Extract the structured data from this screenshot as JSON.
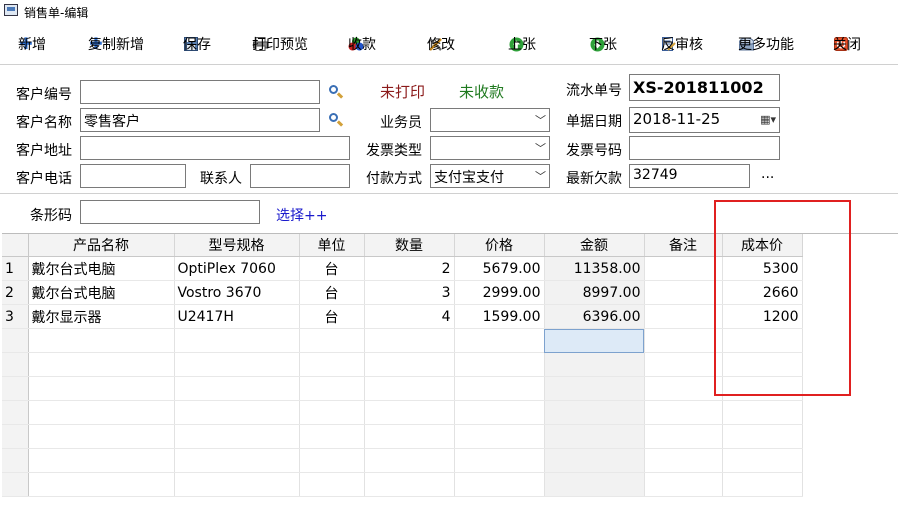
{
  "window": {
    "title": "销售单-编辑"
  },
  "toolbar": {
    "add": "新增",
    "copy_add": "复制新增",
    "save": "保存",
    "print_preview": "打印预览",
    "collect": "收款",
    "modify": "修改",
    "prev": "上张",
    "next": "下张",
    "unaudit": "反审核",
    "more": "更多功能",
    "close": "关闭"
  },
  "form": {
    "customer_no_label": "客户编号",
    "customer_no_value": "",
    "customer_name_label": "客户名称",
    "customer_name_value": "零售客户",
    "customer_addr_label": "客户地址",
    "customer_addr_value": "",
    "customer_phone_label": "客户电话",
    "customer_phone_value": "",
    "contact_label": "联系人",
    "contact_value": "",
    "print_status": "未打印",
    "collect_status": "未收款",
    "salesman_label": "业务员",
    "salesman_value": "",
    "invoice_type_label": "发票类型",
    "invoice_type_value": "",
    "payment_label": "付款方式",
    "payment_value": "支付宝支付",
    "serial_label": "流水单号",
    "serial_value": "XS-201811002",
    "date_label": "单据日期",
    "date_value": "2018-11-25",
    "invoice_no_label": "发票号码",
    "invoice_no_value": "",
    "debt_label": "最新欠款",
    "debt_value": "32749",
    "more_btn": "...",
    "barcode_label": "条形码",
    "barcode_value": "",
    "select_link": "选择++"
  },
  "colors": {
    "print_status": "#8b1a1a",
    "collect_status": "#1f7a1f",
    "link": "#1a1acc",
    "highlight": "#e02020"
  },
  "table": {
    "headers": [
      "产品名称",
      "型号规格",
      "单位",
      "数量",
      "价格",
      "金额",
      "备注",
      "成本价"
    ],
    "rows": [
      {
        "no": "1",
        "name": "戴尔台式电脑",
        "model": "OptiPlex 7060",
        "unit": "台",
        "qty": "2",
        "price": "5679.00",
        "amount": "11358.00",
        "note": "",
        "cost": "5300"
      },
      {
        "no": "2",
        "name": "戴尔台式电脑",
        "model": "Vostro 3670",
        "unit": "台",
        "qty": "3",
        "price": "2999.00",
        "amount": "8997.00",
        "note": "",
        "cost": "2660"
      },
      {
        "no": "3",
        "name": "戴尔显示器",
        "model": "U2417H",
        "unit": "台",
        "qty": "4",
        "price": "1599.00",
        "amount": "6396.00",
        "note": "",
        "cost": "1200"
      }
    ]
  }
}
